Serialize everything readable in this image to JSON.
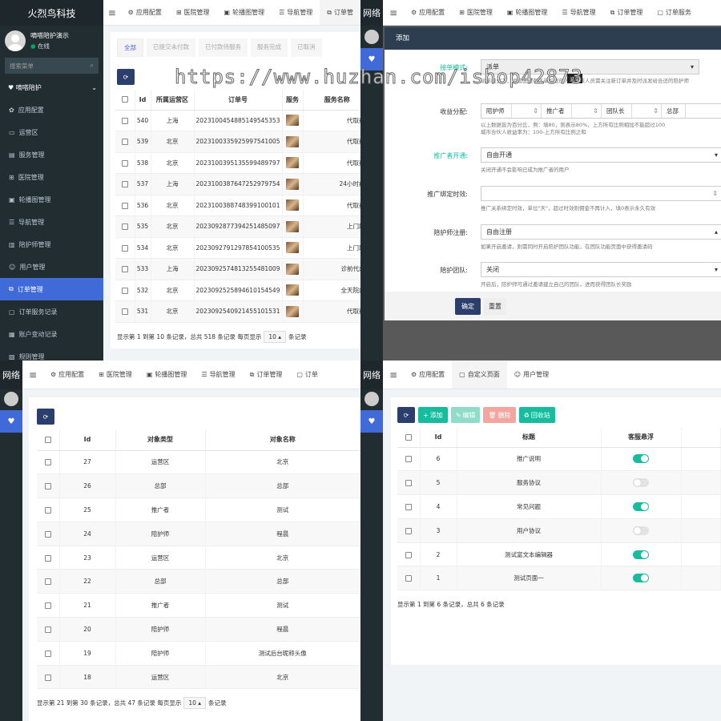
{
  "brand": "火烈鸟科技",
  "brand_short": "网络",
  "user": {
    "name": "嘀嗒陪护演示",
    "status": "在线"
  },
  "search_placeholder": "搜索菜单",
  "sidebar": {
    "header": "嘀嗒陪护",
    "items": [
      "应用配置",
      "运营区",
      "服务管理",
      "医院管理",
      "轮播图管理",
      "导航管理",
      "陪护师管理",
      "用户管理",
      "订单管理",
      "订单服务记录",
      "账户变动记录",
      "规则管理"
    ]
  },
  "tabs_q1": [
    "应用配置",
    "医院管理",
    "轮播图管理",
    "导航管理",
    "订单管"
  ],
  "tabs_q2": [
    "应用配置",
    "医院管理",
    "轮播图管理",
    "导航管理",
    "订单管理",
    "订单服务"
  ],
  "tabs_q3": [
    "应用配置",
    "医院管理",
    "轮播图管理",
    "导航管理",
    "订单管理",
    "订单"
  ],
  "tabs_q4": [
    "应用配置",
    "自定义页面",
    "用户管理"
  ],
  "orders": {
    "filters": [
      "全部",
      "已提交未付款",
      "已付款待服务",
      "服务完成",
      "已取消"
    ],
    "headers": [
      "Id",
      "所属运营区",
      "订单号",
      "服务",
      "服务名称"
    ],
    "rows": [
      {
        "id": "540",
        "area": "上海",
        "no": "2023100454885149545353",
        "name": "代取药送"
      },
      {
        "id": "539",
        "area": "北京",
        "no": "2023100335925997541005",
        "name": "代取药送"
      },
      {
        "id": "538",
        "area": "北京",
        "no": "2023100395135599489797",
        "name": "代取药送"
      },
      {
        "id": "537",
        "area": "上海",
        "no": "2023100387647252979754",
        "name": "24小时病患"
      },
      {
        "id": "536",
        "area": "北京",
        "no": "2023100388748399100101",
        "name": "代取药送"
      },
      {
        "id": "535",
        "area": "北京",
        "no": "2023092877394251485097",
        "name": "上门助浴"
      },
      {
        "id": "534",
        "area": "北京",
        "no": "2023092791297854100535",
        "name": "上门助浴"
      },
      {
        "id": "533",
        "area": "上海",
        "no": "2023092574813255481009",
        "name": "诊前代办约"
      },
      {
        "id": "532",
        "area": "北京",
        "no": "2023092525894610154549",
        "name": "全天院内陪"
      },
      {
        "id": "531",
        "area": "北京",
        "no": "2023092540921455101531",
        "name": "代取药送"
      }
    ],
    "footer": [
      "显示第 1 到第 10 条记录，总共 518 条记录 每页显示",
      "10",
      "条记录"
    ]
  },
  "form": {
    "title": "添加",
    "watermark": "https://www.huzhan.com/ishop42873",
    "fields": [
      {
        "label": "接单模式:",
        "value": "派单",
        "help": "派单模式下，运营区域有派单权限的人员，该人员需关注新订单并及时派发给合适的陪护师",
        "tooltip": "派单"
      },
      {
        "label": "收益分配:",
        "parts": [
          "陪护师",
          "推广者",
          "团队长",
          "总部"
        ],
        "help": "以上数据皆为百分比，例：填80，则表示80%，上方所有比例相加不能超过100",
        "help2": "城市合伙人收益率为：100-上方所有比例之和"
      },
      {
        "label": "推广者开通:",
        "value": "自由开通",
        "help": "关闭开通不会影响已成为推广者的用户"
      },
      {
        "label": "推广绑定时效:",
        "value": "",
        "help": "推广关系绑定时效，单位\"天\"，超过时效则佣金不再计入，填0表示永久有效"
      },
      {
        "label": "陪护师注册:",
        "value": "自由注册",
        "help": "如果开启邀请，则需同时开启陪护团队功能，在团队功能页面中获得邀请码"
      },
      {
        "label": "陪护团队:",
        "value": "关闭",
        "help": "开启后，陪护师可通过邀请建立自己的团队，进而获得团队长奖励"
      }
    ],
    "submit": "确定",
    "reset": "重置"
  },
  "types": {
    "headers": [
      "Id",
      "对象类型",
      "对象名称"
    ],
    "rows": [
      {
        "id": "27",
        "type": "运营区",
        "name": "北京",
        "color": "red"
      },
      {
        "id": "26",
        "type": "总部",
        "name": "总部",
        "color": "green"
      },
      {
        "id": "25",
        "type": "推广者",
        "name": "测试",
        "color": "blue"
      },
      {
        "id": "24",
        "type": "陪护师",
        "name": "程晨",
        "color": "plain"
      },
      {
        "id": "23",
        "type": "运营区",
        "name": "北京",
        "color": "red"
      },
      {
        "id": "22",
        "type": "总部",
        "name": "总部",
        "color": "green"
      },
      {
        "id": "21",
        "type": "推广者",
        "name": "测试",
        "color": "blue"
      },
      {
        "id": "20",
        "type": "陪护师",
        "name": "程晨",
        "color": "plain"
      },
      {
        "id": "19",
        "type": "陪护师",
        "name": "测试后台昵称头像",
        "color": "plain"
      },
      {
        "id": "18",
        "type": "运营区",
        "name": "北京",
        "color": "red"
      }
    ],
    "footer": [
      "显示第 21 到第 30 条记录，总共 47 条记录 每页显示",
      "10",
      "条记录"
    ]
  },
  "pages": {
    "buttons": [
      "添加",
      "编辑",
      "删除",
      "回收站"
    ],
    "headers": [
      "Id",
      "标题",
      "客服悬浮"
    ],
    "rows": [
      {
        "id": "6",
        "title": "推广说明",
        "on": true
      },
      {
        "id": "5",
        "title": "服务协议",
        "on": false
      },
      {
        "id": "4",
        "title": "常见问题",
        "on": true
      },
      {
        "id": "3",
        "title": "用户协议",
        "on": false
      },
      {
        "id": "2",
        "title": "测试富文本编辑器",
        "on": true
      },
      {
        "id": "1",
        "title": "测试页面一",
        "on": true
      }
    ],
    "footer": "显示第 1 到第 6 条记录，总共 6 条记录"
  }
}
